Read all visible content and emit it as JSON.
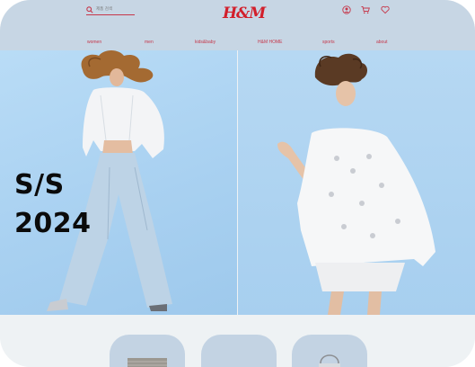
{
  "header": {
    "search": {
      "placeholder": "제품 검색"
    },
    "logo": "H&M",
    "icons": {
      "search": "search-icon",
      "account": "user-icon",
      "cart": "cart-icon",
      "wishlist": "heart-icon"
    }
  },
  "nav": {
    "items": [
      {
        "label": "women"
      },
      {
        "label": "men"
      },
      {
        "label": "kids&baby"
      },
      {
        "label": "H&M HOME"
      },
      {
        "label": "sports"
      },
      {
        "label": "about"
      }
    ]
  },
  "hero": {
    "season_line1": "S/S",
    "season_line2": "2024"
  },
  "categories": [
    {
      "icon": "knit-product-thumbnail"
    },
    {
      "icon": "product-thumbnail"
    },
    {
      "icon": "bag-product-thumbnail"
    }
  ],
  "colors": {
    "header_bg": "#c7d6e4",
    "brand_red": "#d21f2b",
    "nav_text": "#c6374a",
    "hero_blue": "#a9d1f1"
  }
}
